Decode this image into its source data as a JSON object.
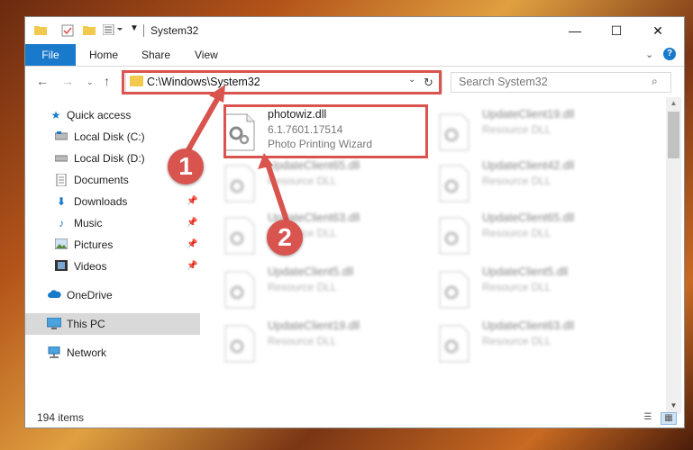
{
  "window": {
    "title": "System32"
  },
  "ribbon": {
    "file": "File",
    "tabs": [
      "Home",
      "Share",
      "View"
    ]
  },
  "address": {
    "path": "C:\\Windows\\System32"
  },
  "search": {
    "placeholder": "Search System32"
  },
  "sidebar": {
    "items": [
      {
        "label": "Quick access",
        "icon": "star-icon"
      },
      {
        "label": "Local Disk (C:)",
        "icon": "drive-icon"
      },
      {
        "label": "Local Disk (D:)",
        "icon": "drive-icon"
      },
      {
        "label": "Documents",
        "icon": "documents-icon"
      },
      {
        "label": "Downloads",
        "icon": "download-icon"
      },
      {
        "label": "Music",
        "icon": "music-icon"
      },
      {
        "label": "Pictures",
        "icon": "pictures-icon"
      },
      {
        "label": "Videos",
        "icon": "videos-icon"
      },
      {
        "label": "OneDrive",
        "icon": "cloud-icon"
      },
      {
        "label": "This PC",
        "icon": "computer-icon"
      },
      {
        "label": "Network",
        "icon": "network-icon"
      }
    ]
  },
  "files": [
    {
      "name": "photowiz.dll",
      "version": "6.1.7601.17514",
      "description": "Photo Printing Wizard"
    },
    {
      "name": "UpdateClient19.dll",
      "description": "Resource DLL"
    },
    {
      "name": "UpdateClient65.dll",
      "description": "Resource DLL"
    },
    {
      "name": "UpdateClient42.dll",
      "description": "Resource DLL"
    },
    {
      "name": "UpdateClient63.dll",
      "description": "Resource DLL"
    },
    {
      "name": "UpdateClient65.dll",
      "description": "Resource DLL"
    },
    {
      "name": "UpdateClient5.dll",
      "description": "Resource DLL"
    },
    {
      "name": "UpdateClient5.dll",
      "description": "Resource DLL"
    },
    {
      "name": "UpdateClient19.dll",
      "description": "Resource DLL"
    },
    {
      "name": "UpdateClient63.dll",
      "description": "Resource DLL"
    }
  ],
  "status": {
    "count": "194 items"
  },
  "annotations": {
    "marker1": "1",
    "marker2": "2"
  },
  "colors": {
    "accent": "#1979ca",
    "annotation": "#d9534f",
    "selected": "#d9d9d9"
  }
}
